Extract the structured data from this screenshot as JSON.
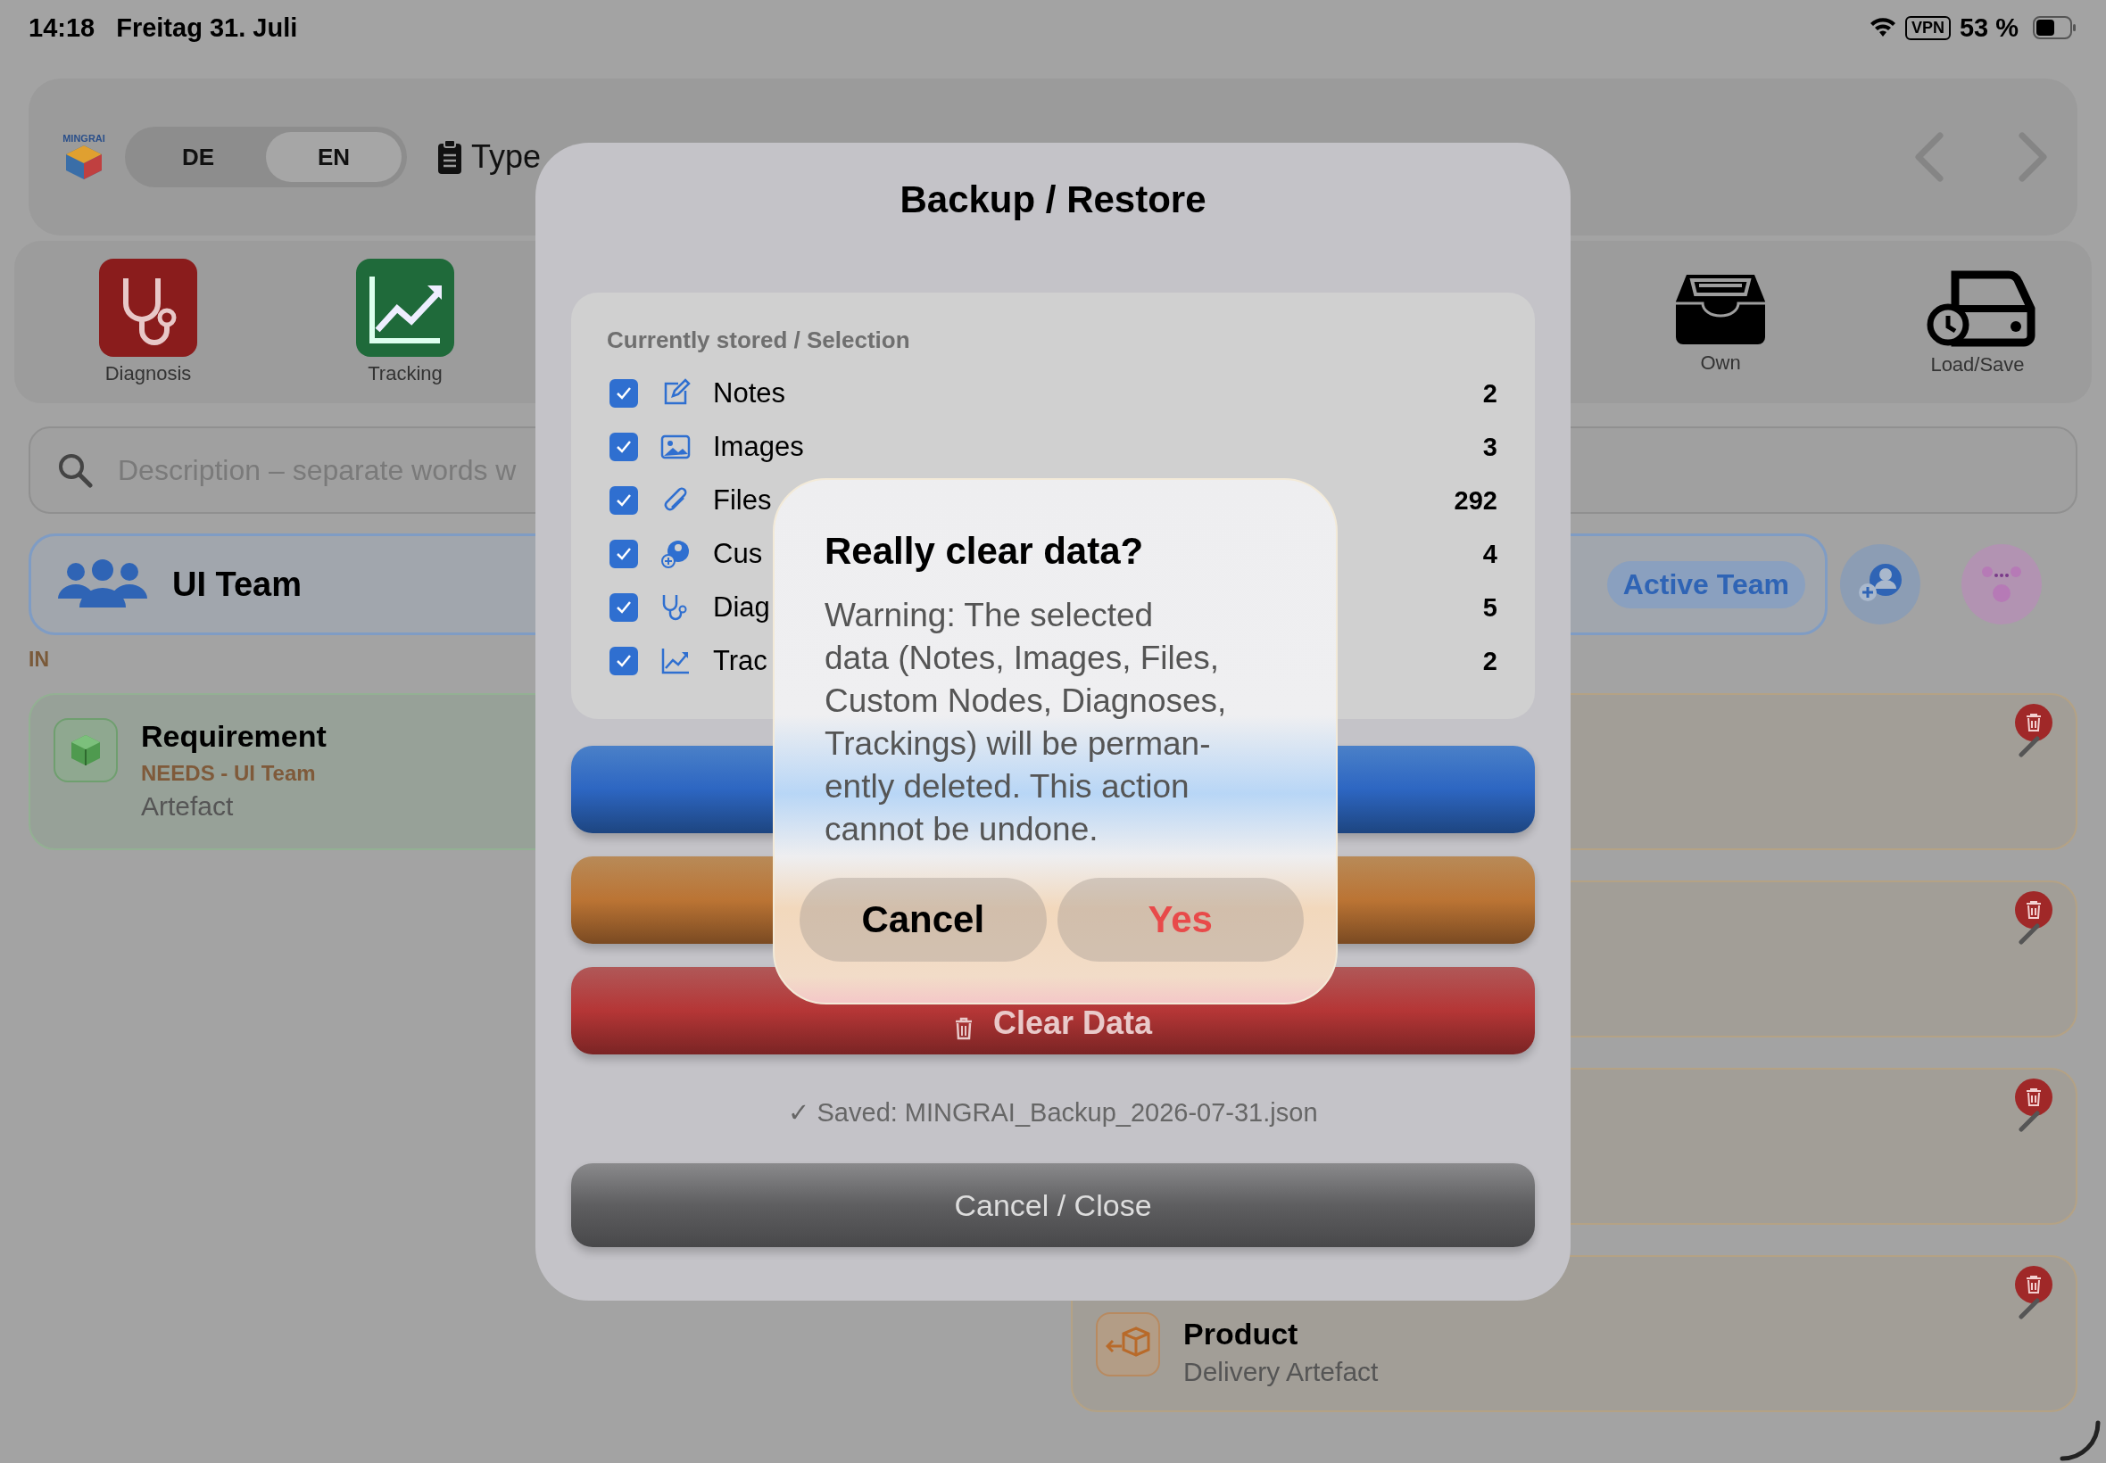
{
  "status_bar": {
    "time": "14:18",
    "date": "Freitag 31. Juli",
    "vpn": "VPN",
    "battery": "53 %"
  },
  "header": {
    "logo_text": "MINGRAI",
    "languages": [
      {
        "label": "DE",
        "selected": false
      },
      {
        "label": "EN",
        "selected": true
      }
    ],
    "type_label": "Type"
  },
  "toolbar": [
    {
      "label": "Diagnosis",
      "kind": "diagnosis"
    },
    {
      "label": "Tracking",
      "kind": "tracking"
    },
    {
      "label": "Own",
      "kind": "own"
    },
    {
      "label": "Load/Save",
      "kind": "load"
    }
  ],
  "search": {
    "placeholder": "Description – separate words w"
  },
  "team": {
    "name": "UI Team",
    "badge": "Active Team"
  },
  "section_label": "IN",
  "left_cards": [
    {
      "title": "Requirement",
      "relation": "NEEDS - UI Team",
      "subtitle": "Artefact"
    }
  ],
  "right_cards": [
    {
      "kind": "blank"
    },
    {
      "kind": "blank"
    },
    {
      "kind": "blank"
    },
    {
      "kind": "item",
      "title": "Product",
      "subtitle": "Delivery Artefact"
    }
  ],
  "modal": {
    "title": "Backup / Restore",
    "section_title": "Currently stored / Selection",
    "items": [
      {
        "label": "Notes",
        "count": "2",
        "checked": true,
        "kind": "notes"
      },
      {
        "label": "Images",
        "count": "3",
        "checked": true,
        "kind": "images"
      },
      {
        "label": "Files",
        "count": "292",
        "checked": true,
        "kind": "files"
      },
      {
        "label": "Cus",
        "count": "4",
        "checked": true,
        "kind": "nodes"
      },
      {
        "label": "Diag",
        "count": "5",
        "checked": true,
        "kind": "diagnoses"
      },
      {
        "label": "Trac",
        "count": "2",
        "checked": true,
        "kind": "trackings"
      }
    ],
    "actions": [
      {
        "kind": "export"
      },
      {
        "kind": "import"
      },
      {
        "kind": "clear",
        "label": "Clear Data"
      }
    ],
    "status": "✓ Saved: MINGRAI_Backup_2026-07-31.json",
    "close": "Cancel / Close"
  },
  "alert": {
    "title": "Really clear data?",
    "message": "Warning: The selected\ndata (Notes, Images, Files,\nCustom Nodes, Diagnoses,\nTrackings) will be perman-\nently deleted. This action\ncannot be undone.",
    "buttons": [
      {
        "label": "Cancel",
        "kind": "cancel"
      },
      {
        "label": "Yes",
        "kind": "destructive"
      }
    ]
  }
}
